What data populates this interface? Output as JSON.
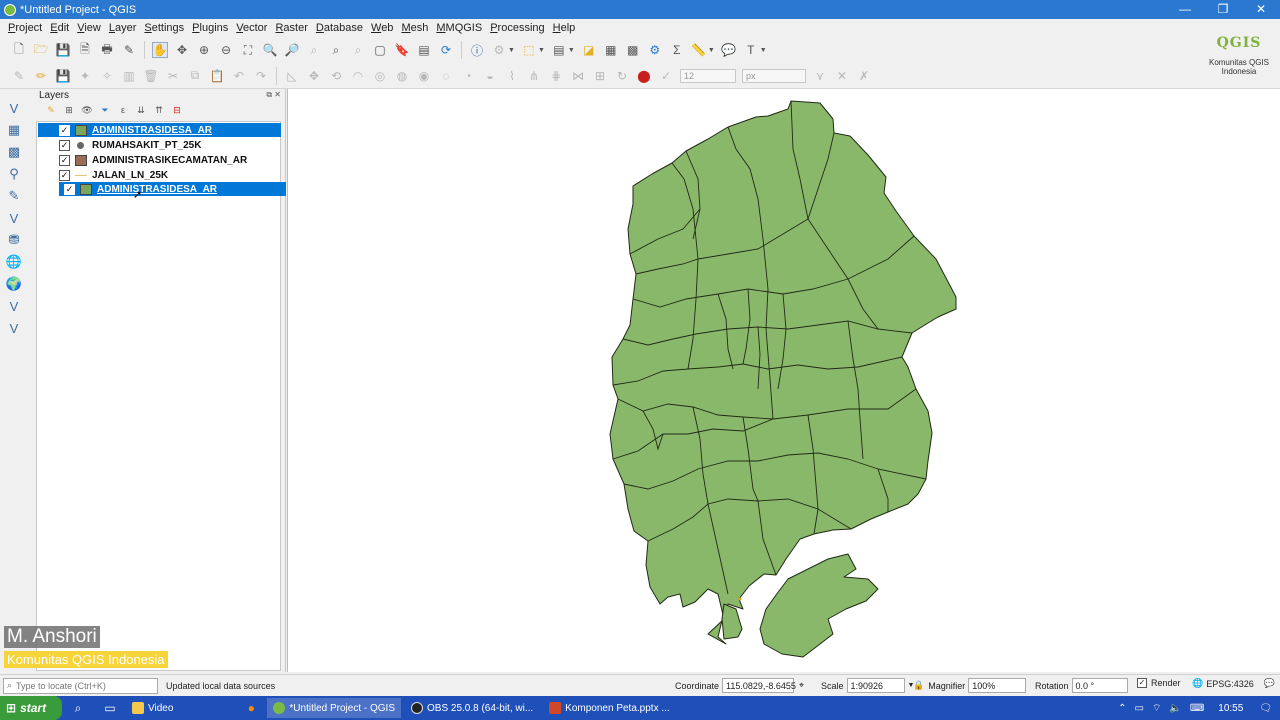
{
  "window": {
    "title": "*Untitled Project - QGIS",
    "controls": [
      "—",
      "❐",
      "✕"
    ]
  },
  "menu": [
    "Project",
    "Edit",
    "View",
    "Layer",
    "Settings",
    "Plugins",
    "Vector",
    "Raster",
    "Database",
    "Web",
    "Mesh",
    "MMQGIS",
    "Processing",
    "Help"
  ],
  "toolbar": {
    "font_size_value": "12",
    "unit_value": "px"
  },
  "logo": {
    "mark": "QGIS",
    "line1": "Komunitas QGIS",
    "line2": "Indonesia"
  },
  "layers_panel": {
    "title": "Layers",
    "layers": [
      {
        "name": "ADMINISTRASIDESA_AR",
        "checked": true,
        "selected": true,
        "symbol": "fill",
        "color": "#7aa55c"
      },
      {
        "name": "RUMAHSAKIT_PT_25K",
        "checked": true,
        "selected": false,
        "symbol": "point",
        "color": "#666666"
      },
      {
        "name": "ADMINISTRASIKECAMATAN_AR",
        "checked": true,
        "selected": false,
        "symbol": "fill",
        "color": "#9c6b54"
      },
      {
        "name": "JALAN_LN_25K",
        "checked": true,
        "selected": false,
        "symbol": "line",
        "color": "#e4c47a"
      },
      {
        "name": "ADMINISTRASIDESA_AR",
        "checked": true,
        "selected": true,
        "symbol": "fill",
        "color": "#7aa55c"
      }
    ]
  },
  "map": {
    "fill": "#8ab86a",
    "stroke": "#1f2a16"
  },
  "watermark": {
    "name": "M. Anshori",
    "org": "Komunitas QGIS Indonesia"
  },
  "statusbar": {
    "locator_placeholder": "Type to locate (Ctrl+K)",
    "message": "Updated local data sources",
    "coordinate_label": "Coordinate",
    "coordinate_value": "115.0829,-8.6455",
    "scale_label": "Scale",
    "scale_value": "1:90926",
    "magnifier_label": "Magnifier",
    "magnifier_value": "100%",
    "rotation_label": "Rotation",
    "rotation_value": "0.0 °",
    "render_label": "Render",
    "crs": "EPSG:4326"
  },
  "taskbar": {
    "start": "start",
    "tasks": [
      {
        "label": "Video",
        "active": false
      },
      {
        "label": "*Untitled Project - QGIS",
        "active": true
      },
      {
        "label": "OBS 25.0.8 (64-bit, wi...",
        "active": false
      },
      {
        "label": "Komponen Peta.pptx ...",
        "active": false
      }
    ],
    "clock": "10:55"
  }
}
